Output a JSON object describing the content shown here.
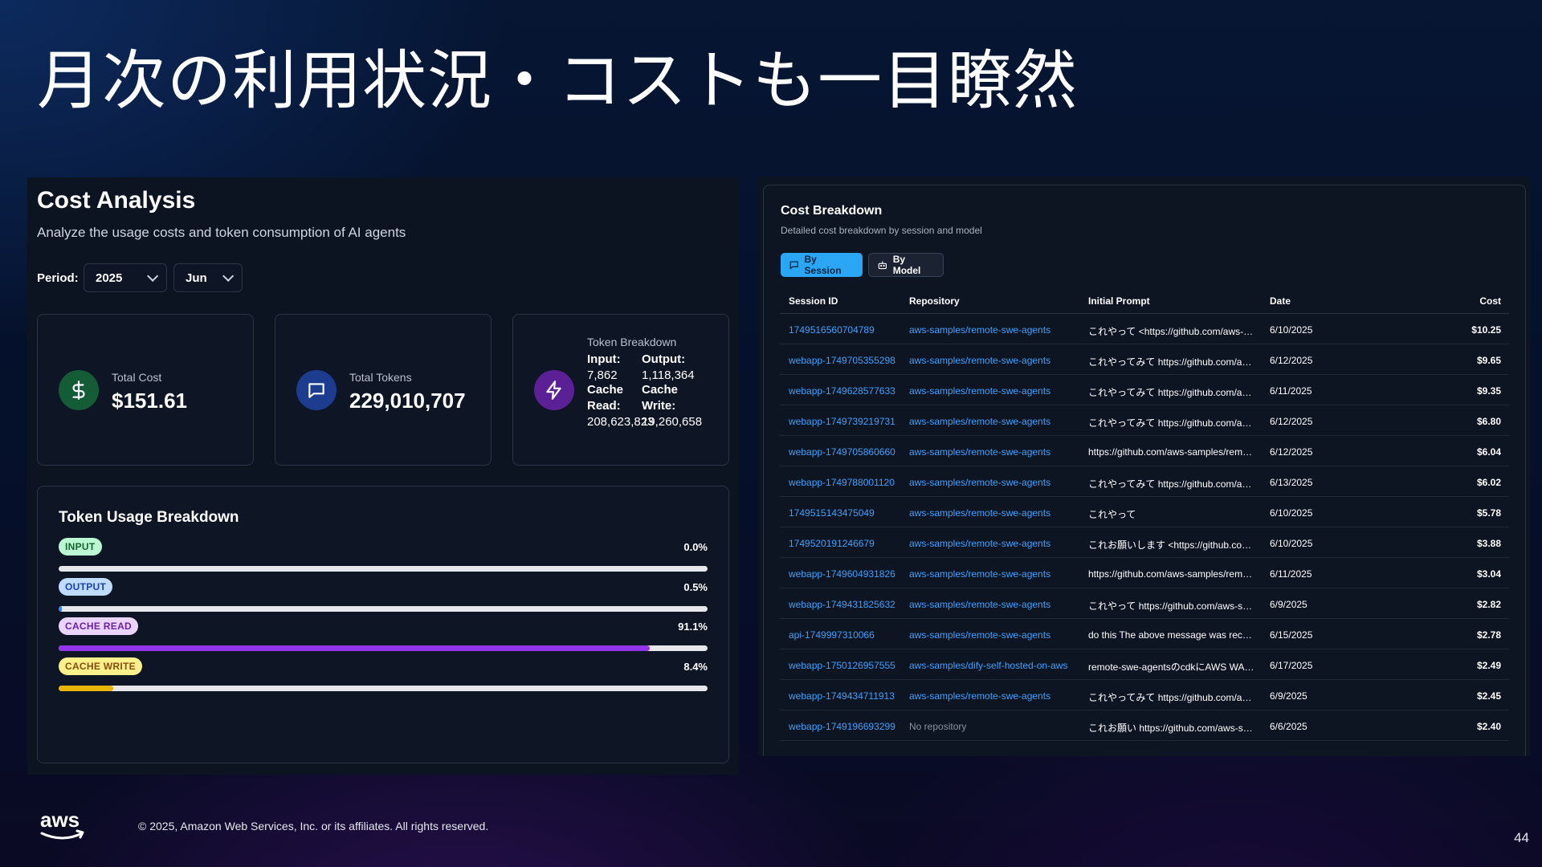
{
  "slide": {
    "title": "月次の利用状況・コストも一目瞭然",
    "copyright": "© 2025, Amazon Web Services, Inc. or its affiliates. All rights reserved.",
    "page_number": "44",
    "logo_text": "aws"
  },
  "cost_analysis": {
    "title": "Cost Analysis",
    "subtitle": "Analyze the usage costs and token consumption of AI agents",
    "period_label": "Period:",
    "year": "2025",
    "month": "Jun",
    "total_cost": {
      "label": "Total Cost",
      "value": "$151.61",
      "icon": "dollar-icon"
    },
    "total_tokens": {
      "label": "Total Tokens",
      "value": "229,010,707",
      "icon": "message-icon"
    },
    "token_breakdown": {
      "title": "Token Breakdown",
      "icon": "zap-icon",
      "input_label": "Input:",
      "input_value": "7,862",
      "output_label": "Output:",
      "output_value": "1,118,364",
      "cache_read_label_1": "Cache",
      "cache_read_label_2": "Read:",
      "cache_read_value": "208,623,823",
      "cache_write_label_1": "Cache",
      "cache_write_label_2": "Write:",
      "cache_write_value": "19,260,658"
    },
    "usage": {
      "title": "Token Usage Breakdown",
      "rows": [
        {
          "label": "INPUT",
          "percent_text": "0.0%",
          "percent": 0.0,
          "badge_bg": "#bbf7d0",
          "badge_fg": "#166534",
          "bar_color": "#22c55e"
        },
        {
          "label": "OUTPUT",
          "percent_text": "0.5%",
          "percent": 0.5,
          "badge_bg": "#bfdbfe",
          "badge_fg": "#1e40af",
          "bar_color": "#3b82f6"
        },
        {
          "label": "CACHE READ",
          "percent_text": "91.1%",
          "percent": 91.1,
          "badge_bg": "#e9d5ff",
          "badge_fg": "#6b21a8",
          "bar_color": "#9333ea"
        },
        {
          "label": "CACHE WRITE",
          "percent_text": "8.4%",
          "percent": 8.4,
          "badge_bg": "#fef08a",
          "badge_fg": "#854d0e",
          "bar_color": "#eab308"
        }
      ]
    }
  },
  "cost_breakdown": {
    "title": "Cost Breakdown",
    "subtitle": "Detailed cost breakdown by session and model",
    "tabs": {
      "by_session": "By Session",
      "by_model": "By Model"
    },
    "columns": {
      "session_id": "Session ID",
      "repository": "Repository",
      "initial_prompt": "Initial Prompt",
      "date": "Date",
      "cost": "Cost"
    },
    "rows": [
      {
        "session_id": "1749516560704789",
        "repository": "aws-samples/remote-swe-agents",
        "prompt": "これやって <https://github.com/aws-sample...",
        "date": "6/10/2025",
        "cost": "$10.25"
      },
      {
        "session_id": "webapp-1749705355298",
        "repository": "aws-samples/remote-swe-agents",
        "prompt": "これやってみて https://github.com/aws-samp...",
        "date": "6/12/2025",
        "cost": "$9.65"
      },
      {
        "session_id": "webapp-1749628577633",
        "repository": "aws-samples/remote-swe-agents",
        "prompt": "これやってみて https://github.com/aws-samp...",
        "date": "6/11/2025",
        "cost": "$9.35"
      },
      {
        "session_id": "webapp-1749739219731",
        "repository": "aws-samples/remote-swe-agents",
        "prompt": "これやってみて https://github.com/aws-samp...",
        "date": "6/12/2025",
        "cost": "$6.80"
      },
      {
        "session_id": "webapp-1749705860660",
        "repository": "aws-samples/remote-swe-agents",
        "prompt": "https://github.com/aws-samples/remote-sw...",
        "date": "6/12/2025",
        "cost": "$6.04"
      },
      {
        "session_id": "webapp-1749788001120",
        "repository": "aws-samples/remote-swe-agents",
        "prompt": "これやってみて https://github.com/aws-samp...",
        "date": "6/13/2025",
        "cost": "$6.02"
      },
      {
        "session_id": "1749515143475049",
        "repository": "aws-samples/remote-swe-agents",
        "prompt": "これやって",
        "date": "6/10/2025",
        "cost": "$5.78"
      },
      {
        "session_id": "1749520191246679",
        "repository": "aws-samples/remote-swe-agents",
        "prompt": "これお願いします <https://github.com/aws-s...",
        "date": "6/10/2025",
        "cost": "$3.88"
      },
      {
        "session_id": "webapp-1749604931826",
        "repository": "aws-samples/remote-swe-agents",
        "prompt": "https://github.com/aws-samples/remote-sw...",
        "date": "6/11/2025",
        "cost": "$3.04"
      },
      {
        "session_id": "webapp-1749431825632",
        "repository": "aws-samples/remote-swe-agents",
        "prompt": "これやって https://github.com/aws-samples/...",
        "date": "6/9/2025",
        "cost": "$2.82"
      },
      {
        "session_id": "api-1749997310066",
        "repository": "aws-samples/remote-swe-agents",
        "prompt": "do this The above message was received fr...",
        "date": "6/15/2025",
        "cost": "$2.78"
      },
      {
        "session_id": "webapp-1750126957555",
        "repository": "aws-samples/dify-self-hosted-on-aws",
        "prompt": "remote-swe-agentsのcdkにAWS WAFとの統...",
        "date": "6/17/2025",
        "cost": "$2.49"
      },
      {
        "session_id": "webapp-1749434711913",
        "repository": "aws-samples/remote-swe-agents",
        "prompt": "これやってみて https://github.com/aws-samp...",
        "date": "6/9/2025",
        "cost": "$2.45"
      },
      {
        "session_id": "webapp-1749196693299",
        "repository": "No repository",
        "prompt": "これお願い https://github.com/aws-samples/...",
        "date": "6/6/2025",
        "cost": "$2.40"
      }
    ]
  }
}
